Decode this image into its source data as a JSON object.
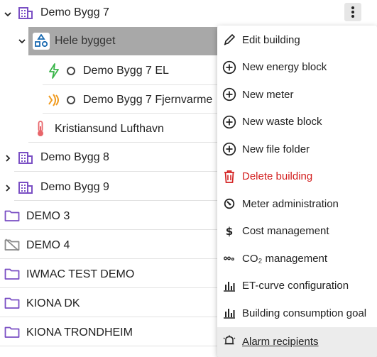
{
  "tree": {
    "items": [
      {
        "label": "Demo Bygg 7",
        "icon": "building-icon"
      },
      {
        "label": "Hele bygget",
        "icon": "shapes-icon",
        "selected": true
      },
      {
        "label": "Demo Bygg 7 EL",
        "icon": "lightning-icon"
      },
      {
        "label": "Demo Bygg 7 Fjernvarme",
        "icon": "district-heating-icon"
      },
      {
        "label": "Kristiansund Lufthavn",
        "icon": "thermometer-icon"
      },
      {
        "label": "Demo Bygg 8",
        "icon": "building-icon"
      },
      {
        "label": "Demo Bygg 9",
        "icon": "building-icon"
      },
      {
        "label": "DEMO 3",
        "icon": "folder-icon"
      },
      {
        "label": "DEMO 4",
        "icon": "folder-off-icon"
      },
      {
        "label": "IWMAC TEST DEMO",
        "icon": "folder-icon"
      },
      {
        "label": "KIONA DK",
        "icon": "folder-icon"
      },
      {
        "label": "KIONA TRONDHEIM",
        "icon": "folder-icon"
      }
    ]
  },
  "colors": {
    "building": "#7a4fc4",
    "folder": "#7a4fc4",
    "selected_bg": "#a8a8a8",
    "shapes_icon": "#1a6ab0",
    "lightning": "#3ab54a",
    "heating": "#f09a1e",
    "thermometer": "#e8656a",
    "danger": "#d32020"
  },
  "context_menu": {
    "items": [
      {
        "label": "Edit building",
        "icon": "pencil-icon"
      },
      {
        "label": "New energy block",
        "icon": "plus-circle-icon"
      },
      {
        "label": "New meter",
        "icon": "plus-circle-icon"
      },
      {
        "label": "New waste block",
        "icon": "plus-circle-icon"
      },
      {
        "label": "New file folder",
        "icon": "plus-circle-icon"
      },
      {
        "label": "Delete building",
        "icon": "trash-icon",
        "danger": true
      },
      {
        "label": "Meter administration",
        "icon": "meter-icon"
      },
      {
        "label": "Cost management",
        "icon": "dollar-icon"
      },
      {
        "label": "CO₂ management",
        "icon": "co2-icon"
      },
      {
        "label": "ET-curve configuration",
        "icon": "bar-chart-icon"
      },
      {
        "label": "Building consumption goal",
        "icon": "bar-chart-icon"
      },
      {
        "label": "Alarm recipients",
        "icon": "bell-icon",
        "hovered": true
      }
    ]
  }
}
